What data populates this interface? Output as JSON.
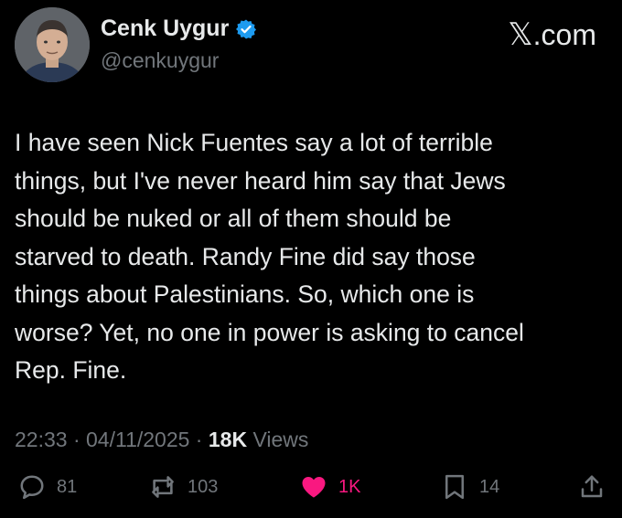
{
  "author": {
    "name": "Cenk Uygur",
    "handle": "@cenkuygur",
    "verified": true
  },
  "brand": {
    "x": "𝕏",
    "domain": ".com"
  },
  "post": {
    "text": "I have seen Nick Fuentes say a lot of terrible\nthings, but I've never heard him say that Jews\nshould be nuked or all of them should be\nstarved to death. Randy Fine did say those\nthings about Palestinians. So, which one is\nworse? Yet, no one in power is asking to cancel\nRep. Fine."
  },
  "meta": {
    "time": "22:33",
    "separator": " · ",
    "date": "04/11/2025",
    "views_count": "18K",
    "views_label": " Views"
  },
  "actions": {
    "replies": "81",
    "reposts": "103",
    "likes": "1K",
    "bookmarks": "14"
  },
  "colors": {
    "background": "#000000",
    "text": "#e7e9ea",
    "muted": "#71767b",
    "like": "#f91880",
    "verified": "#1d9bf0"
  },
  "icons": [
    "verified-badge-icon",
    "reply-icon",
    "repost-icon",
    "like-heart-icon",
    "bookmark-icon",
    "share-icon"
  ]
}
